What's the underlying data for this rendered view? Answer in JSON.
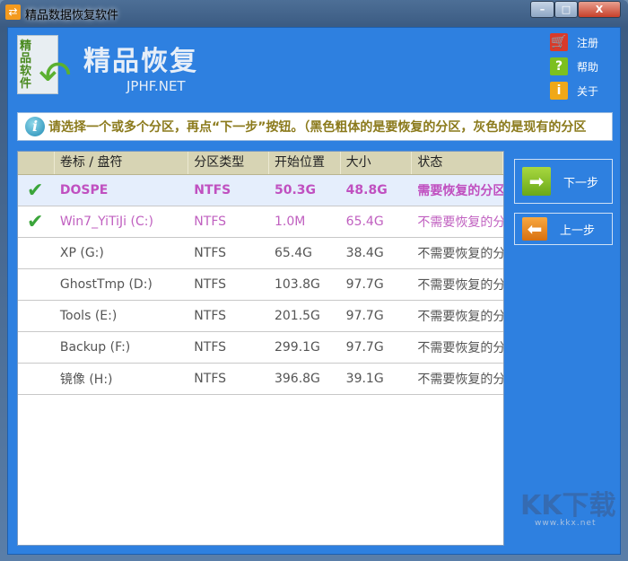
{
  "window": {
    "title": "精品数据恢复软件",
    "minimize": "–",
    "maximize": "□",
    "close": "X"
  },
  "header": {
    "logo_text": "精品软件",
    "brand": "精品恢复",
    "sub": "JPHF.NET"
  },
  "side_links": [
    {
      "label": "注册",
      "icon": "cart-icon",
      "color": "#d83a2a",
      "glyph": "🛒"
    },
    {
      "label": "帮助",
      "icon": "help-icon",
      "color": "#7cc020",
      "glyph": "?"
    },
    {
      "label": "关于",
      "icon": "info-icon",
      "color": "#f0a818",
      "glyph": "i"
    }
  ],
  "info": {
    "text": "请选择一个或多个分区，再点“下一步”按钮。（黑色粗体的是要恢复的分区，灰色的是现有的分区"
  },
  "table": {
    "columns": [
      "",
      "卷标 / 盘符",
      "分区类型",
      "开始位置",
      "大小",
      "状态"
    ],
    "rows": [
      {
        "checked": true,
        "name": "DOSPE",
        "type": "NTFS",
        "start": "50.3G",
        "size": "48.8G",
        "status": "需要恢复的分区",
        "style": "recover"
      },
      {
        "checked": true,
        "name": "Win7_YiTiJi (C:)",
        "type": "NTFS",
        "start": "1.0M",
        "size": "65.4G",
        "status": "不需要恢复的分区",
        "style": "existing-checked"
      },
      {
        "checked": false,
        "name": "XP (G:)",
        "type": "NTFS",
        "start": "65.4G",
        "size": "38.4G",
        "status": "不需要恢复的分区",
        "style": "existing"
      },
      {
        "checked": false,
        "name": "GhostTmp (D:)",
        "type": "NTFS",
        "start": "103.8G",
        "size": "97.7G",
        "status": "不需要恢复的分区",
        "style": "existing"
      },
      {
        "checked": false,
        "name": "Tools (E:)",
        "type": "NTFS",
        "start": "201.5G",
        "size": "97.7G",
        "status": "不需要恢复的分区",
        "style": "existing"
      },
      {
        "checked": false,
        "name": "Backup (F:)",
        "type": "NTFS",
        "start": "299.1G",
        "size": "97.7G",
        "status": "不需要恢复的分区",
        "style": "existing"
      },
      {
        "checked": false,
        "name": "镜像 (H:)",
        "type": "NTFS",
        "start": "396.8G",
        "size": "39.1G",
        "status": "不需要恢复的分区",
        "style": "existing"
      }
    ]
  },
  "buttons": {
    "next": "下一步",
    "prev": "上一步"
  },
  "watermark": {
    "text": "KK下载",
    "url": "www.kkx.net"
  },
  "colors": {
    "client_bg": "#2e80e0",
    "recover_text": "#c050c0",
    "existing_checked_text": "#c060c0",
    "existing_text": "#555555",
    "header_bg": "#d7d4b4"
  }
}
